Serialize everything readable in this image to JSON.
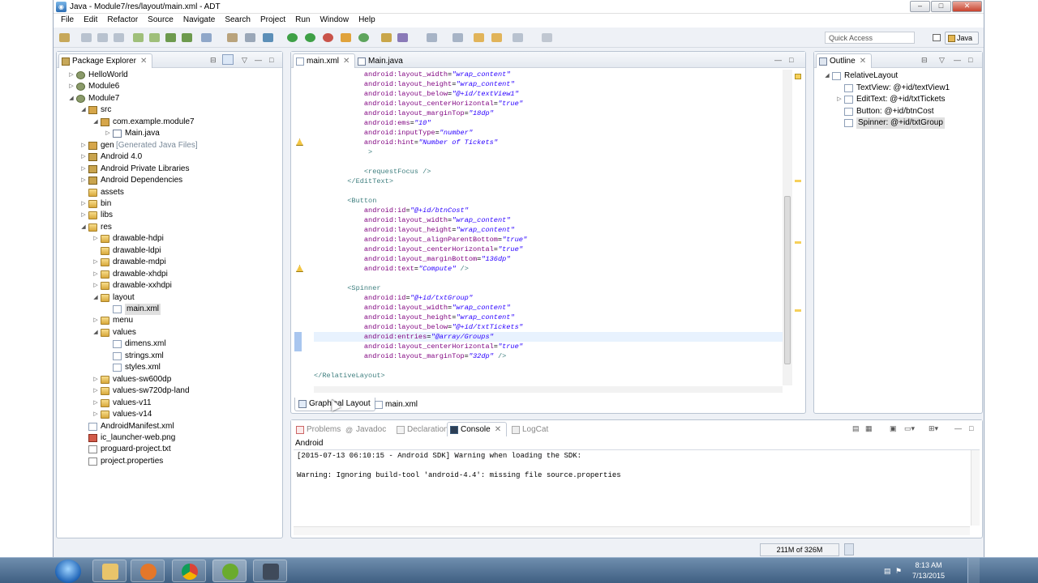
{
  "window": {
    "title": "Java - Module7/res/layout/main.xml - ADT",
    "buttons": [
      "–",
      "□",
      "✕"
    ]
  },
  "menu": [
    "File",
    "Edit",
    "Refactor",
    "Source",
    "Navigate",
    "Search",
    "Project",
    "Run",
    "Window",
    "Help"
  ],
  "toolbar": {
    "quick_access_placeholder": "Quick Access",
    "perspective": "Java"
  },
  "package_explorer": {
    "title": "Package Explorer",
    "items": [
      {
        "label": "HelloWorld",
        "icon": "project-icon",
        "depth": 0,
        "twisty": "▷"
      },
      {
        "label": "Module6",
        "icon": "project-icon",
        "depth": 0,
        "twisty": "▷"
      },
      {
        "label": "Module7",
        "icon": "project-icon",
        "depth": 0,
        "twisty": "◢"
      },
      {
        "label": "src",
        "icon": "source-folder-icon",
        "depth": 1,
        "twisty": "◢"
      },
      {
        "label": "com.example.module7",
        "icon": "package-icon",
        "depth": 2,
        "twisty": "◢"
      },
      {
        "label": "Main.java",
        "icon": "java-file-icon",
        "depth": 3,
        "twisty": "▷"
      },
      {
        "label": "gen",
        "suffix": "[Generated Java Files]",
        "icon": "source-folder-icon",
        "depth": 1,
        "twisty": "▷"
      },
      {
        "label": "Android 4.0",
        "icon": "library-icon",
        "depth": 1,
        "twisty": "▷"
      },
      {
        "label": "Android Private Libraries",
        "icon": "library-icon",
        "depth": 1,
        "twisty": "▷"
      },
      {
        "label": "Android Dependencies",
        "icon": "library-icon",
        "depth": 1,
        "twisty": "▷"
      },
      {
        "label": "assets",
        "icon": "folder-icon",
        "depth": 1,
        "twisty": ""
      },
      {
        "label": "bin",
        "icon": "folder-icon",
        "depth": 1,
        "twisty": "▷"
      },
      {
        "label": "libs",
        "icon": "folder-icon",
        "depth": 1,
        "twisty": "▷"
      },
      {
        "label": "res",
        "icon": "folder-icon",
        "depth": 1,
        "twisty": "◢"
      },
      {
        "label": "drawable-hdpi",
        "icon": "folder-icon",
        "depth": 2,
        "twisty": "▷"
      },
      {
        "label": "drawable-ldpi",
        "icon": "folder-icon",
        "depth": 2,
        "twisty": ""
      },
      {
        "label": "drawable-mdpi",
        "icon": "folder-icon",
        "depth": 2,
        "twisty": "▷"
      },
      {
        "label": "drawable-xhdpi",
        "icon": "folder-icon",
        "depth": 2,
        "twisty": "▷"
      },
      {
        "label": "drawable-xxhdpi",
        "icon": "folder-icon",
        "depth": 2,
        "twisty": "▷"
      },
      {
        "label": "layout",
        "icon": "folder-icon",
        "depth": 2,
        "twisty": "◢"
      },
      {
        "label": "main.xml",
        "icon": "xml-file-icon",
        "depth": 3,
        "twisty": "",
        "selected": true
      },
      {
        "label": "menu",
        "icon": "folder-icon",
        "depth": 2,
        "twisty": "▷"
      },
      {
        "label": "values",
        "icon": "folder-icon",
        "depth": 2,
        "twisty": "◢"
      },
      {
        "label": "dimens.xml",
        "icon": "xml-file-icon",
        "depth": 3,
        "twisty": ""
      },
      {
        "label": "strings.xml",
        "icon": "xml-file-icon",
        "depth": 3,
        "twisty": ""
      },
      {
        "label": "styles.xml",
        "icon": "xml-file-icon",
        "depth": 3,
        "twisty": ""
      },
      {
        "label": "values-sw600dp",
        "icon": "folder-icon",
        "depth": 2,
        "twisty": "▷"
      },
      {
        "label": "values-sw720dp-land",
        "icon": "folder-icon",
        "depth": 2,
        "twisty": "▷"
      },
      {
        "label": "values-v11",
        "icon": "folder-icon",
        "depth": 2,
        "twisty": "▷"
      },
      {
        "label": "values-v14",
        "icon": "folder-icon",
        "depth": 2,
        "twisty": "▷"
      },
      {
        "label": "AndroidManifest.xml",
        "icon": "xml-file-icon",
        "depth": 1,
        "twisty": ""
      },
      {
        "label": "ic_launcher-web.png",
        "icon": "image-file-icon",
        "depth": 1,
        "twisty": ""
      },
      {
        "label": "proguard-project.txt",
        "icon": "text-file-icon",
        "depth": 1,
        "twisty": ""
      },
      {
        "label": "project.properties",
        "icon": "text-file-icon",
        "depth": 1,
        "twisty": ""
      }
    ]
  },
  "editor": {
    "tabs": [
      {
        "label": "main.xml",
        "active": true
      },
      {
        "label": "Main.java",
        "active": false
      }
    ],
    "bottom_tabs": [
      {
        "label": "Graphical Layout",
        "active": true
      },
      {
        "label": "main.xml",
        "active": false
      }
    ],
    "lines": [
      [
        [
          "            ",
          "plain"
        ],
        [
          "android:layout_width",
          "attr"
        ],
        [
          "=",
          "plain"
        ],
        [
          "\"wrap_content\"",
          "val"
        ]
      ],
      [
        [
          "            ",
          "plain"
        ],
        [
          "android:layout_height",
          "attr"
        ],
        [
          "=",
          "plain"
        ],
        [
          "\"wrap_content\"",
          "val"
        ]
      ],
      [
        [
          "            ",
          "plain"
        ],
        [
          "android:layout_below",
          "attr"
        ],
        [
          "=",
          "plain"
        ],
        [
          "\"@+id/textView1\"",
          "val"
        ]
      ],
      [
        [
          "            ",
          "plain"
        ],
        [
          "android:layout_centerHorizontal",
          "attr"
        ],
        [
          "=",
          "plain"
        ],
        [
          "\"true\"",
          "val"
        ]
      ],
      [
        [
          "            ",
          "plain"
        ],
        [
          "android:layout_marginTop",
          "attr"
        ],
        [
          "=",
          "plain"
        ],
        [
          "\"18dp\"",
          "val"
        ]
      ],
      [
        [
          "            ",
          "plain"
        ],
        [
          "android:ems",
          "attr"
        ],
        [
          "=",
          "plain"
        ],
        [
          "\"10\"",
          "val"
        ]
      ],
      [
        [
          "            ",
          "plain"
        ],
        [
          "android:inputType",
          "attr"
        ],
        [
          "=",
          "plain"
        ],
        [
          "\"number\"",
          "val"
        ]
      ],
      [
        [
          "            ",
          "plain"
        ],
        [
          "android:hint",
          "attr"
        ],
        [
          "=",
          "plain"
        ],
        [
          "\"Number of Tickets\"",
          "val"
        ]
      ],
      [
        [
          "             ",
          "plain"
        ],
        [
          ">",
          "tag"
        ]
      ],
      [
        [
          "",
          "plain"
        ]
      ],
      [
        [
          "            ",
          "plain"
        ],
        [
          "<requestFocus />",
          "tag"
        ]
      ],
      [
        [
          "        ",
          "plain"
        ],
        [
          "</EditText>",
          "tag"
        ]
      ],
      [
        [
          "",
          "plain"
        ]
      ],
      [
        [
          "        ",
          "plain"
        ],
        [
          "<Button",
          "tag"
        ]
      ],
      [
        [
          "            ",
          "plain"
        ],
        [
          "android:id",
          "attr"
        ],
        [
          "=",
          "plain"
        ],
        [
          "\"@+id/btnCost\"",
          "val"
        ]
      ],
      [
        [
          "            ",
          "plain"
        ],
        [
          "android:layout_width",
          "attr"
        ],
        [
          "=",
          "plain"
        ],
        [
          "\"wrap_content\"",
          "val"
        ]
      ],
      [
        [
          "            ",
          "plain"
        ],
        [
          "android:layout_height",
          "attr"
        ],
        [
          "=",
          "plain"
        ],
        [
          "\"wrap_content\"",
          "val"
        ]
      ],
      [
        [
          "            ",
          "plain"
        ],
        [
          "android:layout_alignParentBottom",
          "attr"
        ],
        [
          "=",
          "plain"
        ],
        [
          "\"true\"",
          "val"
        ]
      ],
      [
        [
          "            ",
          "plain"
        ],
        [
          "android:layout_centerHorizontal",
          "attr"
        ],
        [
          "=",
          "plain"
        ],
        [
          "\"true\"",
          "val"
        ]
      ],
      [
        [
          "            ",
          "plain"
        ],
        [
          "android:layout_marginBottom",
          "attr"
        ],
        [
          "=",
          "plain"
        ],
        [
          "\"136dp\"",
          "val"
        ]
      ],
      [
        [
          "            ",
          "plain"
        ],
        [
          "android:text",
          "attr"
        ],
        [
          "=",
          "plain"
        ],
        [
          "\"Compute\"",
          "val"
        ],
        [
          " />",
          "tag"
        ]
      ],
      [
        [
          "",
          "plain"
        ]
      ],
      [
        [
          "        ",
          "plain"
        ],
        [
          "<Spinner",
          "tag"
        ]
      ],
      [
        [
          "            ",
          "plain"
        ],
        [
          "android:id",
          "attr"
        ],
        [
          "=",
          "plain"
        ],
        [
          "\"@+id/txtGroup\"",
          "val"
        ]
      ],
      [
        [
          "            ",
          "plain"
        ],
        [
          "android:layout_width",
          "attr"
        ],
        [
          "=",
          "plain"
        ],
        [
          "\"wrap_content\"",
          "val"
        ]
      ],
      [
        [
          "            ",
          "plain"
        ],
        [
          "android:layout_height",
          "attr"
        ],
        [
          "=",
          "plain"
        ],
        [
          "\"wrap_content\"",
          "val"
        ]
      ],
      [
        [
          "            ",
          "plain"
        ],
        [
          "android:layout_below",
          "attr"
        ],
        [
          "=",
          "plain"
        ],
        [
          "\"@+id/txtTickets\"",
          "val"
        ]
      ],
      [
        [
          "            ",
          "plain"
        ],
        [
          "android:entries",
          "attr"
        ],
        [
          "=",
          "plain"
        ],
        [
          "\"@array/Groups\"",
          "val"
        ]
      ],
      [
        [
          "            ",
          "plain"
        ],
        [
          "android:layout_centerHorizontal",
          "attr"
        ],
        [
          "=",
          "plain"
        ],
        [
          "\"true\"",
          "val"
        ]
      ],
      [
        [
          "            ",
          "plain"
        ],
        [
          "android:layout_marginTop",
          "attr"
        ],
        [
          "=",
          "plain"
        ],
        [
          "\"32dp\"",
          "val"
        ],
        [
          " />",
          "tag"
        ]
      ],
      [
        [
          "",
          "plain"
        ]
      ],
      [
        [
          "",
          "plain"
        ],
        [
          "</RelativeLayout>",
          "tag"
        ]
      ]
    ],
    "warning_lines": [
      7,
      20
    ],
    "current_line": 27
  },
  "outline": {
    "title": "Outline",
    "items": [
      {
        "label": "RelativeLayout",
        "depth": 0,
        "twisty": "◢",
        "icon": "layout-icon"
      },
      {
        "label": "TextView: @+id/textView1",
        "depth": 1,
        "twisty": "",
        "icon": "textview-icon"
      },
      {
        "label": "EditText: @+id/txtTickets",
        "depth": 1,
        "twisty": "▷",
        "icon": "edittext-icon"
      },
      {
        "label": "Button: @+id/btnCost",
        "depth": 1,
        "twisty": "",
        "icon": "button-icon"
      },
      {
        "label": "Spinner: @+id/txtGroup",
        "depth": 1,
        "twisty": "",
        "icon": "spinner-icon",
        "selected": true
      }
    ]
  },
  "bottom_panel": {
    "tabs": [
      "Problems",
      "Javadoc",
      "Declaration",
      "Console",
      "LogCat"
    ],
    "active_tab": "Console",
    "console_name": "Android",
    "lines": [
      "[2015-07-13 06:10:15 - Android SDK] Warning when loading the SDK:",
      "",
      "Warning: Ignoring build-tool 'android-4.4': missing file source.properties"
    ]
  },
  "status": {
    "heap": "211M of 326M"
  },
  "taskbar": {
    "time": "8:13 AM",
    "date": "7/13/2015"
  }
}
